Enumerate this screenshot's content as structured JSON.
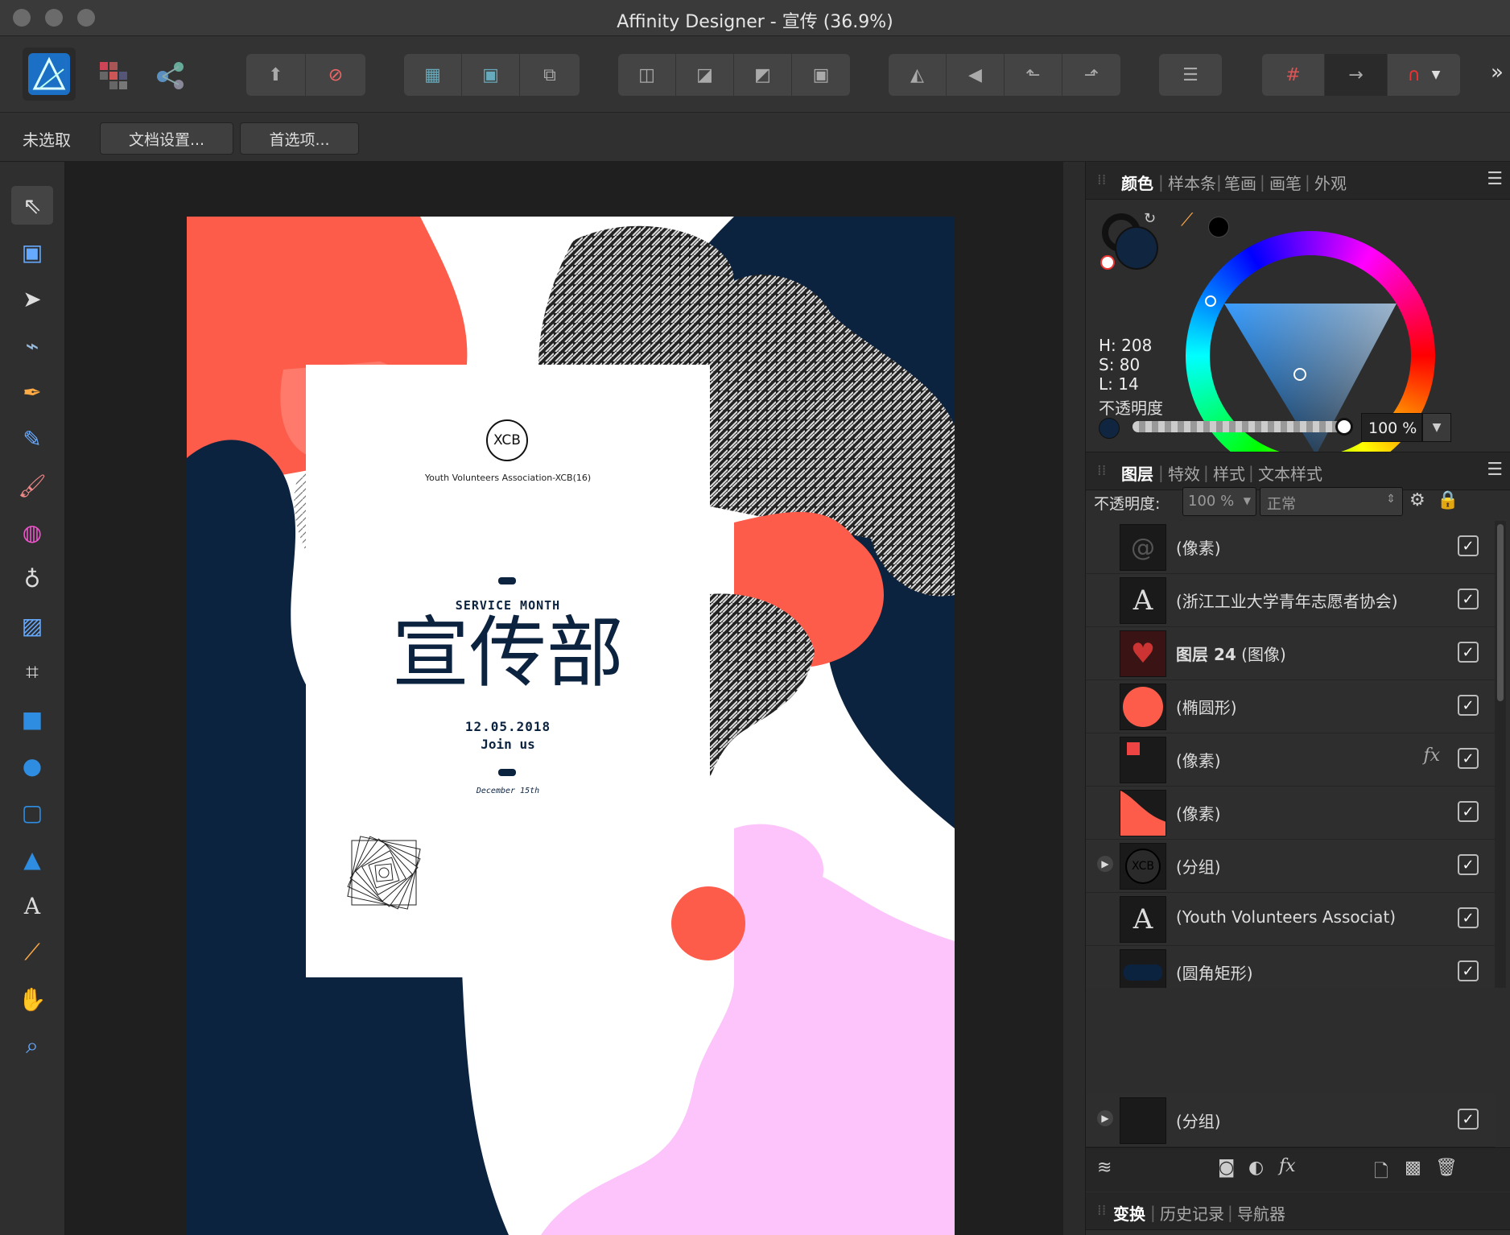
{
  "window": {
    "title": "Affinity Designer - 宣传 (36.9%)"
  },
  "toolbar": {
    "groups": [
      {
        "name": "persona",
        "buttons": [
          "designer-persona-icon"
        ]
      },
      {
        "name": "apps",
        "buttons": [
          "pixel-persona-icon",
          "export-persona-icon"
        ]
      },
      {
        "name": "assistant",
        "buttons": [
          "upload-icon",
          "no-selection-icon"
        ]
      },
      {
        "name": "isolation",
        "buttons": [
          "select-inside-icon",
          "select-outside-icon",
          "transform-origin-icon"
        ]
      },
      {
        "name": "boolean",
        "buttons": [
          "add-icon",
          "subtract-icon",
          "intersect-icon",
          "divide-icon"
        ]
      },
      {
        "name": "arrange",
        "buttons": [
          "flip-h-icon",
          "flip-v-icon",
          "rotate-left-icon",
          "rotate-right-icon"
        ]
      },
      {
        "name": "align",
        "buttons": [
          "align-icon"
        ]
      },
      {
        "name": "snapping",
        "buttons": [
          "grid-icon",
          "snap-icon",
          "magnet-icon"
        ]
      }
    ],
    "overflow": "»"
  },
  "context": {
    "status": "未选取",
    "doc_setup": "文档设置...",
    "preferences": "首选项..."
  },
  "tools": [
    "move-tool-icon",
    "artboard-tool-icon",
    "node-tool-icon",
    "corner-tool-icon",
    "pen-tool-icon",
    "pencil-tool-icon",
    "vector-brush-tool-icon",
    "fill-tool-icon",
    "transparency-tool-icon",
    "place-image-tool-icon",
    "crop-tool-icon",
    "rectangle-tool-icon",
    "ellipse-tool-icon",
    "rounded-rectangle-tool-icon",
    "triangle-tool-icon",
    "text-tool-icon",
    "color-picker-tool-icon",
    "hand-tool-icon",
    "zoom-tool-icon"
  ],
  "poster": {
    "logo": "XCB",
    "org": "Youth Volunteers Association-XCB(16)",
    "service": "SERVICE MONTH",
    "title": "宣传部",
    "date": "12.05.2018",
    "join": "Join us",
    "sub": "December 15th"
  },
  "color_panel": {
    "tabs": [
      "颜色",
      "样本条",
      "笔画",
      "画笔",
      "外观"
    ],
    "h": "H: 208",
    "s": "S: 80",
    "l": "L: 14",
    "opacity_label": "不透明度",
    "opacity_value": "100 %",
    "fill_color": "#0f2540"
  },
  "layers_panel": {
    "tabs": [
      "图层",
      "特效",
      "样式",
      "文本样式"
    ],
    "opacity_label": "不透明度:",
    "opacity_value": "100 %",
    "blend_mode": "正常",
    "layers": [
      {
        "name": "(像素)",
        "bold": "",
        "thumb": "spiral"
      },
      {
        "name": "(浙江工业大学青年志愿者协会)",
        "bold": "",
        "thumb": "text"
      },
      {
        "name": "(图像)",
        "bold": "图层 24",
        "thumb": "heart"
      },
      {
        "name": "(椭圆形)",
        "bold": "",
        "thumb": "circle"
      },
      {
        "name": "(像素)",
        "bold": "",
        "thumb": "pixel-red",
        "fx": "fx"
      },
      {
        "name": "(像素)",
        "bold": "",
        "thumb": "shape-red"
      },
      {
        "name": "(分组)",
        "bold": "",
        "thumb": "xcb",
        "expand": "▶"
      },
      {
        "name": "(Youth Volunteers Associat)",
        "bold": "",
        "thumb": "text"
      },
      {
        "name": "(圆角矩形)",
        "bold": "",
        "thumb": "rounded"
      },
      {
        "name": "(分组)",
        "bold": "",
        "thumb": "dark",
        "expand": "▶"
      }
    ]
  },
  "bottom_panel": {
    "tabs": [
      "变换",
      "历史记录",
      "导航器"
    ]
  }
}
